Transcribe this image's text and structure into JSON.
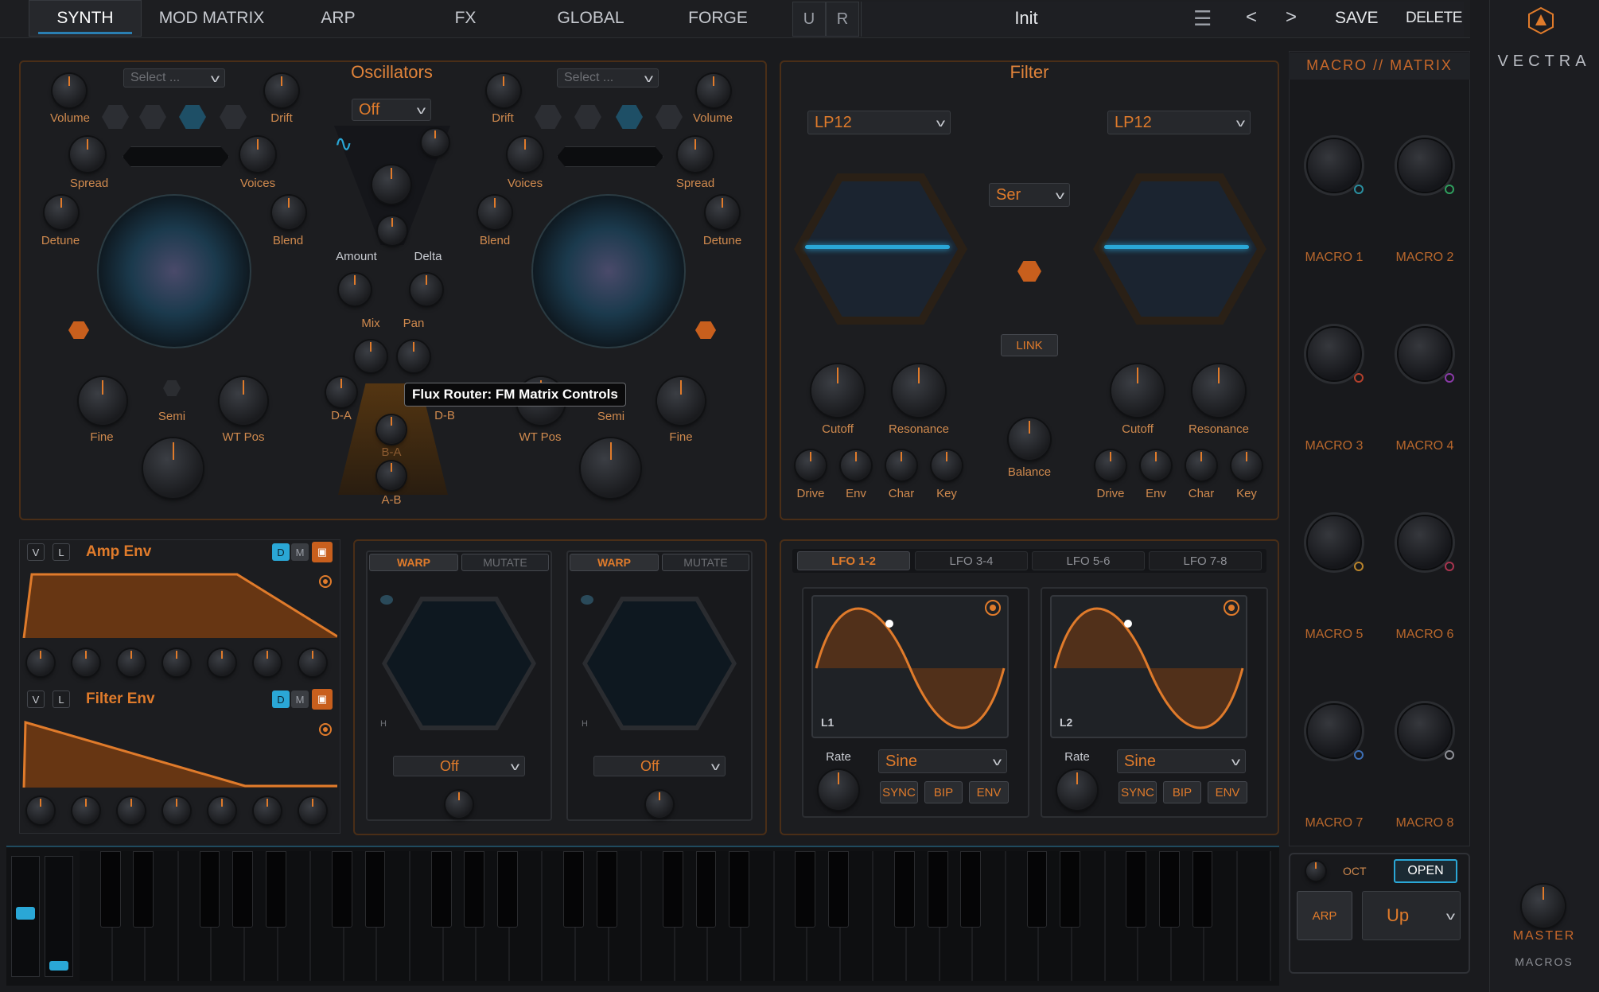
{
  "tabs": [
    "SYNTH",
    "MOD MATRIX",
    "ARP",
    "FX",
    "GLOBAL",
    "FORGE"
  ],
  "active_tab": "SYNTH",
  "ur": [
    "U",
    "R"
  ],
  "preset": {
    "name": "Init",
    "menu": "☰",
    "prev": "<",
    "next": ">",
    "save": "SAVE",
    "delete": "DELETE"
  },
  "brand": {
    "name": "VECTRA"
  },
  "osc": {
    "title": "Oscillators",
    "select_placeholder": "Select ...",
    "center_select": "Off",
    "left": {
      "volume": "Volume",
      "drift": "Drift",
      "spread": "Spread",
      "voices": "Voices",
      "detune": "Detune",
      "blend": "Blend",
      "fine": "Fine",
      "semi": "Semi",
      "wtpos": "WT Pos"
    },
    "right": {
      "volume": "Volume",
      "drift": "Drift",
      "spread": "Spread",
      "voices": "Voices",
      "detune": "Detune",
      "blend": "Blend",
      "fine": "Fine",
      "semi": "Semi",
      "wtpos": "WT Pos"
    },
    "router": {
      "amount": "Amount",
      "delta": "Delta",
      "mix": "Mix",
      "pan": "Pan",
      "da": "D-A",
      "db": "D-B",
      "ba": "B-A",
      "ab": "A-B"
    },
    "tooltip": "Flux Router: FM Matrix Controls"
  },
  "filter": {
    "title": "Filter",
    "type_left": "LP12",
    "type_right": "LP12",
    "routing": "Ser",
    "link": "LINK",
    "balance": "Balance",
    "left": {
      "cutoff": "Cutoff",
      "resonance": "Resonance",
      "drive": "Drive",
      "env": "Env",
      "char": "Char",
      "key": "Key"
    },
    "right": {
      "cutoff": "Cutoff",
      "resonance": "Resonance",
      "drive": "Drive",
      "env": "Env",
      "char": "Char",
      "key": "Key"
    }
  },
  "env": {
    "amp": {
      "title": "Amp Env",
      "v": "V",
      "l": "L",
      "d": "D",
      "m": "M"
    },
    "filter": {
      "title": "Filter Env",
      "v": "V",
      "l": "L",
      "d": "D",
      "m": "M"
    }
  },
  "warp": [
    {
      "warp": "WARP",
      "mutate": "MUTATE",
      "select": "Off",
      "h": "H"
    },
    {
      "warp": "WARP",
      "mutate": "MUTATE",
      "select": "Off",
      "h": "H"
    }
  ],
  "lfo": {
    "tabs": [
      "LFO 1-2",
      "LFO 3-4",
      "LFO 5-6",
      "LFO 7-8"
    ],
    "units": [
      {
        "id": "L1",
        "rate": "Rate",
        "shape": "Sine",
        "sync": "SYNC",
        "bip": "BIP",
        "env": "ENV"
      },
      {
        "id": "L2",
        "rate": "Rate",
        "shape": "Sine",
        "sync": "SYNC",
        "bip": "BIP",
        "env": "ENV"
      }
    ]
  },
  "macros": {
    "title": "MACRO // MATRIX",
    "items": [
      "MACRO 1",
      "MACRO 2",
      "MACRO 3",
      "MACRO 4",
      "MACRO 5",
      "MACRO 6",
      "MACRO 7",
      "MACRO 8"
    ],
    "ring_colors": [
      "#2a8fa0",
      "#2f9e5d",
      "#b3402c",
      "#8a3aa8",
      "#b9842b",
      "#a8344f",
      "#3d6fb5",
      "#8e9096"
    ]
  },
  "arp": {
    "oct": "OCT",
    "open": "OPEN",
    "arp": "ARP",
    "mode": "Up"
  },
  "master": {
    "label": "MASTER",
    "sub": "MACROS"
  },
  "colors": {
    "accent": "#e07b2b",
    "blue": "#2aa7d6",
    "bg": "#1a1b1e"
  }
}
